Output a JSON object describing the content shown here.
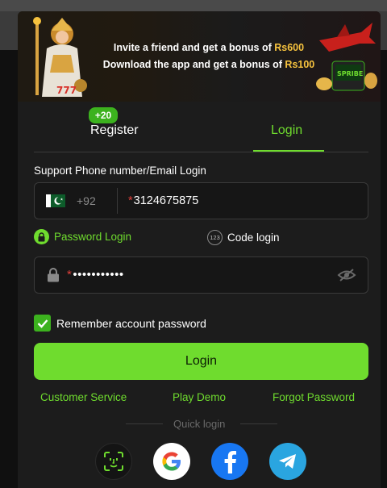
{
  "banner": {
    "line1_text": "Invite a friend and get a bonus of ",
    "line1_amount": "Rs600",
    "line2_text": "Download the app and get a bonus of ",
    "line2_amount": "Rs100"
  },
  "tabs": {
    "register_label": "Register",
    "register_badge": "+20",
    "login_label": "Login",
    "active": "Login"
  },
  "form": {
    "phone_label": "Support Phone number/Email Login",
    "country_code": "+92",
    "phone_value": "3124675875",
    "required_mark": "*",
    "password_mode_label": "Password Login",
    "code_mode_label": "Code login",
    "code_mode_icon_text": "123",
    "password_value": "•••••••••••",
    "remember_label": "Remember account password",
    "remember_checked": true,
    "submit_label": "Login"
  },
  "links": {
    "customer_service": "Customer Service",
    "play_demo": "Play Demo",
    "forgot_password": "Forgot Password"
  },
  "quick_login": {
    "label": "Quick login",
    "providers": [
      "face-id-icon",
      "google-icon",
      "facebook-icon",
      "telegram-icon"
    ]
  },
  "colors": {
    "accent": "#6fdc2e",
    "badge": "#3cb21e",
    "background": "#1c1c1c",
    "required": "#e0403a",
    "banner_amount": "#f6c23e"
  }
}
